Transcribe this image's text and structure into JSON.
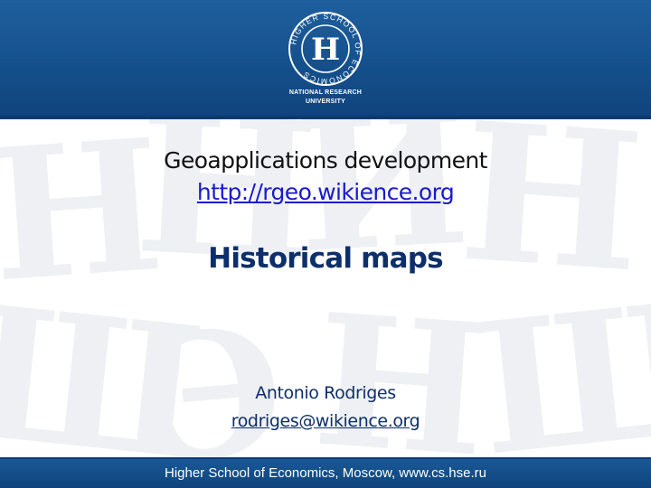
{
  "header": {
    "logo_letter": "Н",
    "logo_ring_text": "HIGHER SCHOOL OF ECONOMICS",
    "caption_line1": "NATIONAL RESEARCH",
    "caption_line2": "UNIVERSITY",
    "band_color": "#15508c"
  },
  "slide": {
    "subtitle": "Geoapplications development",
    "url": "http://rgeo.wikience.org",
    "title": "Historical maps",
    "author": "Antonio Rodriges",
    "email": "rodriges@wikience.org"
  },
  "footer": {
    "text": "Higher School of Economics, Moscow, www.cs.hse.ru"
  },
  "colors": {
    "title": "#0d2f6b",
    "link": "#1a1acc",
    "footer": "#0f437c"
  }
}
